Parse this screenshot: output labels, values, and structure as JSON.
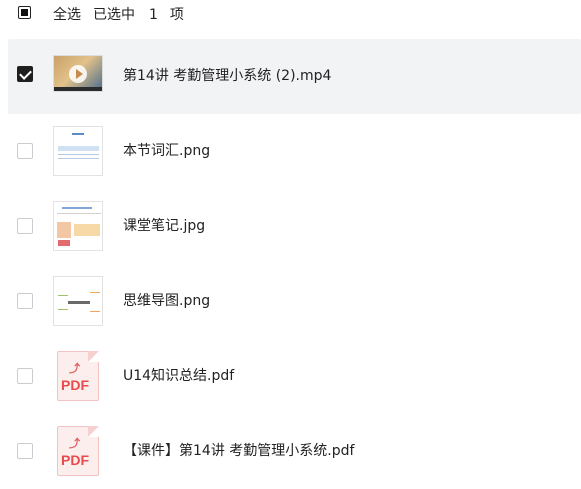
{
  "header": {
    "select_all": "全选",
    "selected_prefix": "已选中",
    "selected_count": "1",
    "selected_unit": "项"
  },
  "files": [
    {
      "name": "第14讲 考勤管理小系统 (2).mp4",
      "type": "video",
      "selected": true
    },
    {
      "name": "本节词汇.png",
      "type": "image",
      "selected": false
    },
    {
      "name": "课堂笔记.jpg",
      "type": "image",
      "selected": false
    },
    {
      "name": "思维导图.png",
      "type": "image",
      "selected": false
    },
    {
      "name": "U14知识总结.pdf",
      "type": "pdf",
      "selected": false,
      "badge": "PDF"
    },
    {
      "name": "【课件】第14讲 考勤管理小系统.pdf",
      "type": "pdf",
      "selected": false,
      "badge": "PDF"
    }
  ]
}
